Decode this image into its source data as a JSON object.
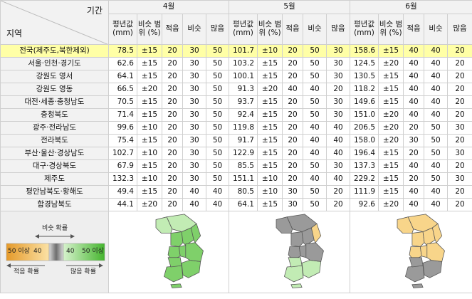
{
  "corner": {
    "top_label": "기간",
    "bottom_label": "지역"
  },
  "months": [
    "4월",
    "5월",
    "6월"
  ],
  "subheaders": [
    "평년값 (mm)",
    "비슷 범위 (%)",
    "적음",
    "비슷",
    "많음"
  ],
  "rows": [
    {
      "region": "전국(제주도,북한제외)",
      "m": [
        [
          "78.5",
          "±15",
          "20",
          "30",
          "50"
        ],
        [
          "101.7",
          "±10",
          "20",
          "50",
          "30"
        ],
        [
          "158.6",
          "±15",
          "40",
          "40",
          "20"
        ]
      ]
    },
    {
      "region": "서울·인천·경기도",
      "m": [
        [
          "62.6",
          "±15",
          "20",
          "30",
          "50"
        ],
        [
          "103.2",
          "±15",
          "20",
          "50",
          "30"
        ],
        [
          "124.5",
          "±20",
          "40",
          "40",
          "20"
        ]
      ]
    },
    {
      "region": "강원도 영서",
      "m": [
        [
          "64.1",
          "±15",
          "20",
          "30",
          "50"
        ],
        [
          "100.1",
          "±15",
          "20",
          "50",
          "30"
        ],
        [
          "130.5",
          "±15",
          "40",
          "40",
          "20"
        ]
      ]
    },
    {
      "region": "강원도 영동",
      "m": [
        [
          "66.5",
          "±20",
          "20",
          "30",
          "50"
        ],
        [
          "91.3",
          "±20",
          "40",
          "40",
          "20"
        ],
        [
          "118.2",
          "±15",
          "40",
          "40",
          "20"
        ]
      ]
    },
    {
      "region": "대전·세종·충청남도",
      "m": [
        [
          "70.5",
          "±15",
          "20",
          "30",
          "50"
        ],
        [
          "93.7",
          "±15",
          "20",
          "50",
          "30"
        ],
        [
          "149.6",
          "±15",
          "40",
          "40",
          "20"
        ]
      ]
    },
    {
      "region": "충청북도",
      "m": [
        [
          "71.4",
          "±15",
          "20",
          "30",
          "50"
        ],
        [
          "92.4",
          "±15",
          "20",
          "50",
          "30"
        ],
        [
          "151.0",
          "±20",
          "40",
          "40",
          "20"
        ]
      ]
    },
    {
      "region": "광주·전라남도",
      "m": [
        [
          "99.6",
          "±10",
          "20",
          "30",
          "50"
        ],
        [
          "119.8",
          "±15",
          "20",
          "40",
          "40"
        ],
        [
          "206.5",
          "±20",
          "20",
          "50",
          "30"
        ]
      ]
    },
    {
      "region": "전라북도",
      "m": [
        [
          "75.4",
          "±15",
          "20",
          "30",
          "50"
        ],
        [
          "91.7",
          "±15",
          "20",
          "40",
          "40"
        ],
        [
          "158.0",
          "±20",
          "30",
          "50",
          "20"
        ]
      ]
    },
    {
      "region": "부산·울산·경상남도",
      "m": [
        [
          "102.7",
          "±10",
          "20",
          "30",
          "50"
        ],
        [
          "122.9",
          "±15",
          "20",
          "40",
          "40"
        ],
        [
          "196.4",
          "±15",
          "20",
          "50",
          "30"
        ]
      ]
    },
    {
      "region": "대구·경상북도",
      "m": [
        [
          "67.9",
          "±15",
          "20",
          "30",
          "50"
        ],
        [
          "85.5",
          "±15",
          "20",
          "50",
          "30"
        ],
        [
          "137.3",
          "±15",
          "40",
          "40",
          "20"
        ]
      ]
    },
    {
      "region": "제주도",
      "m": [
        [
          "132.3",
          "±10",
          "20",
          "30",
          "50"
        ],
        [
          "151.1",
          "±10",
          "20",
          "40",
          "40"
        ],
        [
          "229.2",
          "±15",
          "20",
          "50",
          "30"
        ]
      ]
    },
    {
      "region": "평안남북도·황해도",
      "m": [
        [
          "49.4",
          "±15",
          "20",
          "40",
          "40"
        ],
        [
          "80.5",
          "±10",
          "30",
          "50",
          "20"
        ],
        [
          "111.9",
          "±15",
          "40",
          "40",
          "20"
        ]
      ]
    },
    {
      "region": "함경남북도",
      "m": [
        [
          "44.1",
          "±20",
          "20",
          "40",
          "40"
        ],
        [
          "64.1",
          "±15",
          "30",
          "50",
          "20"
        ],
        [
          "92.6",
          "±20",
          "40",
          "40",
          "20"
        ]
      ]
    }
  ],
  "legend": {
    "similar_label": "비슷 확률",
    "below_label": "적음 확률",
    "above_label": "많음 확률",
    "bar_labels": [
      "50 이상",
      "40",
      "40",
      "50 이상"
    ]
  },
  "colors": {
    "header_bg": "#f2f2f2",
    "highlight": "#ffffa6",
    "above_50": "#7fd06a",
    "above_40": "#c2ecb4",
    "similar": "#9a9a9a",
    "below_40": "#f8d58a",
    "below_50": "#f0a640",
    "grid": "#cfcfcf"
  }
}
